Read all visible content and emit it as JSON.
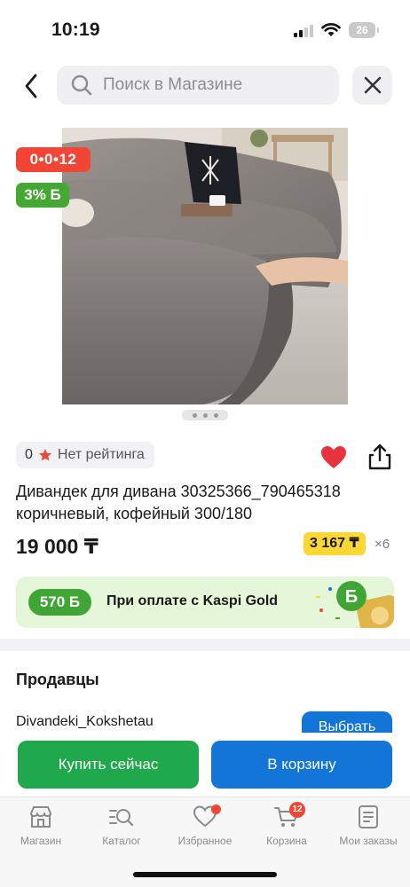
{
  "status_bar": {
    "time": "10:19",
    "battery": "26"
  },
  "header": {
    "search_placeholder": "Поиск в Магазине"
  },
  "product": {
    "timer_badge": "0•0•12",
    "bonus_badge": "3% Б",
    "rating_count": "0",
    "rating_text": "Нет рейтинга",
    "title": "Дивандек для дивана 30325366_790465318 коричневый, кофейный 300/180",
    "price": "19 000 ₸",
    "installment": "3 167 ₸",
    "installment_times": "×6",
    "gallery": {
      "pages": 3,
      "active": 1
    }
  },
  "gold_banner": {
    "bonus": "570 Б",
    "text": "При оплате с Kaspi Gold"
  },
  "sellers": {
    "heading": "Продавцы",
    "seller_name": "Divandeki_Kokshetau",
    "choose_label": "Выбрать"
  },
  "actions": {
    "buy_now": "Купить сейчас",
    "add_to_cart": "В корзину"
  },
  "tabs": [
    {
      "label": "Магазин",
      "icon": "shop-icon"
    },
    {
      "label": "Каталог",
      "icon": "catalog-search-icon"
    },
    {
      "label": "Избранное",
      "icon": "heart-outline-icon"
    },
    {
      "label": "Корзина",
      "icon": "cart-icon",
      "badge": "12"
    },
    {
      "label": "Мои заказы",
      "icon": "orders-icon"
    }
  ],
  "colors": {
    "red": "#f14635",
    "green": "#1fa84c",
    "blue": "#1475d9",
    "yellow": "#fdd835",
    "gold_banner_bg": "#e6f6d8"
  }
}
